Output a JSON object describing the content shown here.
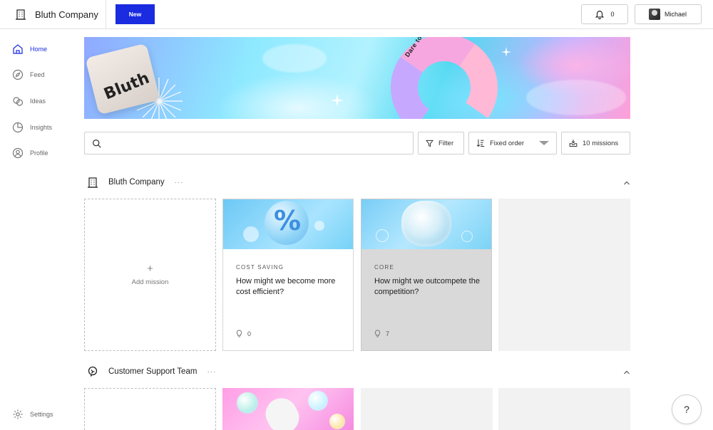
{
  "header": {
    "company_name": "Bluth Company",
    "new_label": "New",
    "notification_count": "0",
    "user_name": "Michael"
  },
  "sidebar": {
    "items": [
      {
        "label": "Home",
        "icon": "home-icon",
        "active": true
      },
      {
        "label": "Feed",
        "icon": "compass-icon"
      },
      {
        "label": "Ideas",
        "icon": "ideas-icon"
      },
      {
        "label": "Insights",
        "icon": "pie-chart-icon"
      },
      {
        "label": "Profile",
        "icon": "user-icon"
      }
    ],
    "settings_label": "Settings"
  },
  "banner": {
    "card_text": "Bluth",
    "arc_text": "Dare to innovate"
  },
  "toolbar": {
    "search_placeholder": "",
    "filter_label": "Filter",
    "order_label": "Fixed order",
    "missions_label": "10 missions"
  },
  "sections": [
    {
      "title": "Bluth Company",
      "more": "···",
      "add_label": "Add mission",
      "missions": [
        {
          "category": "COST SAVING",
          "title": "How might we become more cost efficient?",
          "ideas": "0"
        },
        {
          "category": "CORE",
          "title": "How might we outcompete the competition?",
          "ideas": "7"
        }
      ]
    },
    {
      "title": "Customer Support Team",
      "more": "···"
    }
  ],
  "help_label": "?",
  "colors": {
    "accent": "#1a2be0",
    "border": "#cfcfcf",
    "placeholder": "#f2f2f2"
  }
}
